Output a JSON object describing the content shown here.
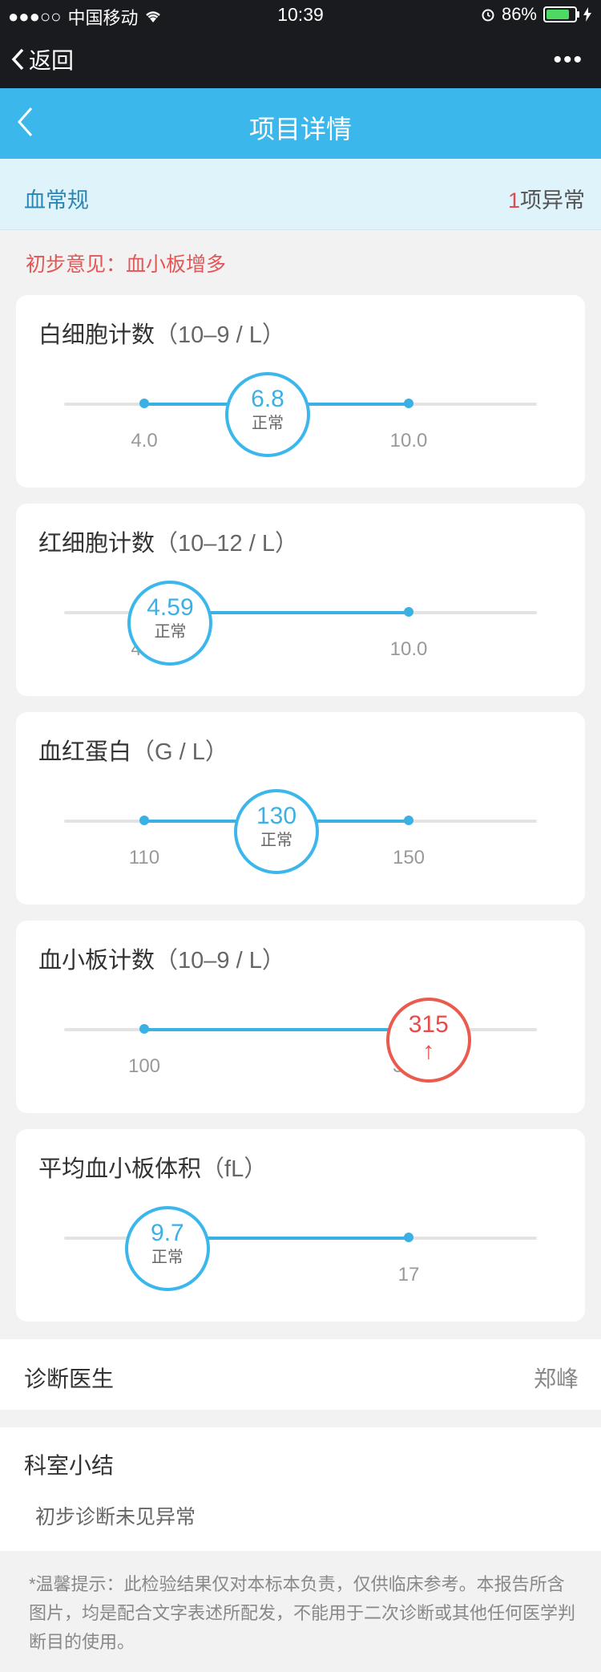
{
  "status_bar": {
    "signal_dots": "●●●○○",
    "carrier": "中国移动",
    "time": "10:39",
    "battery_percent": "86%",
    "battery_level": 0.86
  },
  "nav": {
    "back_label": "返回",
    "more_label": "•••"
  },
  "title_bar": {
    "title": "项目详情"
  },
  "section": {
    "name": "血常规",
    "abnormal_count": "1",
    "abnormal_suffix": "项异常"
  },
  "opinion": "初步意见：血小板增多",
  "cards": [
    {
      "name": "白细胞计数",
      "unit": "（10–9 / L）",
      "min": 4.0,
      "max": 10.0,
      "min_label": "4.0",
      "max_label": "10.0",
      "value": "6.8",
      "status": "正常",
      "abnormal": false
    },
    {
      "name": "红细胞计数",
      "unit": "（10–12 / L）",
      "min": 4.0,
      "max": 10.0,
      "min_label": "4.0",
      "max_label": "10.0",
      "value": "4.59",
      "status": "正常",
      "abnormal": false
    },
    {
      "name": "血红蛋白",
      "unit": "（G / L）",
      "min": 110,
      "max": 150,
      "min_label": "110",
      "max_label": "150",
      "value": "130",
      "status": "正常",
      "abnormal": false
    },
    {
      "name": "血小板计数",
      "unit": "（10–9 / L）",
      "min": 100,
      "max": 300,
      "min_label": "100",
      "max_label": "300",
      "value": "315",
      "status": "↑",
      "abnormal": true
    },
    {
      "name": "平均血小板体积",
      "unit": "（fL）",
      "min": 9,
      "max": 17,
      "min_label": "9",
      "max_label": "17",
      "value": "9.7",
      "status": "正常",
      "abnormal": false
    }
  ],
  "doctor": {
    "label": "诊断医生",
    "name": "郑峰"
  },
  "summary": {
    "label": "科室小结",
    "text": "初步诊断未见异常"
  },
  "tip": "*温馨提示：此检验结果仅对本标本负责，仅供临床参考。本报告所含图片，均是配合文字表述所配发，不能用于二次诊断或其他任何医学判断目的使用。",
  "colors": {
    "accent": "#3bb7eb",
    "abnormal": "#e84a48",
    "section_bg": "#dff3fb"
  }
}
